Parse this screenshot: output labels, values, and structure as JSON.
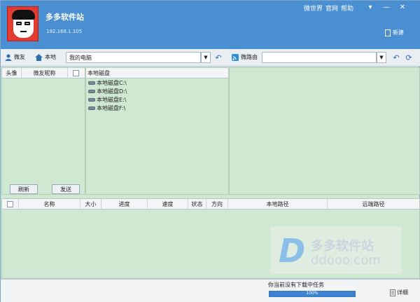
{
  "header": {
    "title": "多多软件站",
    "ip": "192.168.1.105",
    "links": [
      "微世界",
      "官网",
      "帮助"
    ],
    "new_label": "新建",
    "brand_color": "#4a8fd1"
  },
  "toolbar": {
    "friends_label": "微友",
    "local_label": "本地",
    "local_path": "我的电脑",
    "router_label": "微路由",
    "router_path": ""
  },
  "friends_pane": {
    "col_avatar": "头像",
    "col_nickname": "微友昵称",
    "refresh_label": "刷新",
    "send_label": "发送"
  },
  "disk_pane": {
    "header": "本地磁盘",
    "drives": [
      "本地磁盘C:\\",
      "本地磁盘D:\\",
      "本地磁盘E:\\",
      "本地磁盘F:\\"
    ]
  },
  "tasks": {
    "columns": [
      "名称",
      "大小",
      "进度",
      "速度",
      "状态",
      "方向",
      "本地路径",
      "远端路径"
    ]
  },
  "watermark": {
    "logo_letter": "D",
    "line1": "多多软件站",
    "line2": "ddooo.com"
  },
  "status": {
    "message": "你当前没有下载中任务",
    "progress_percent": 100,
    "progress_label": "100%",
    "detail_label": "详细"
  }
}
